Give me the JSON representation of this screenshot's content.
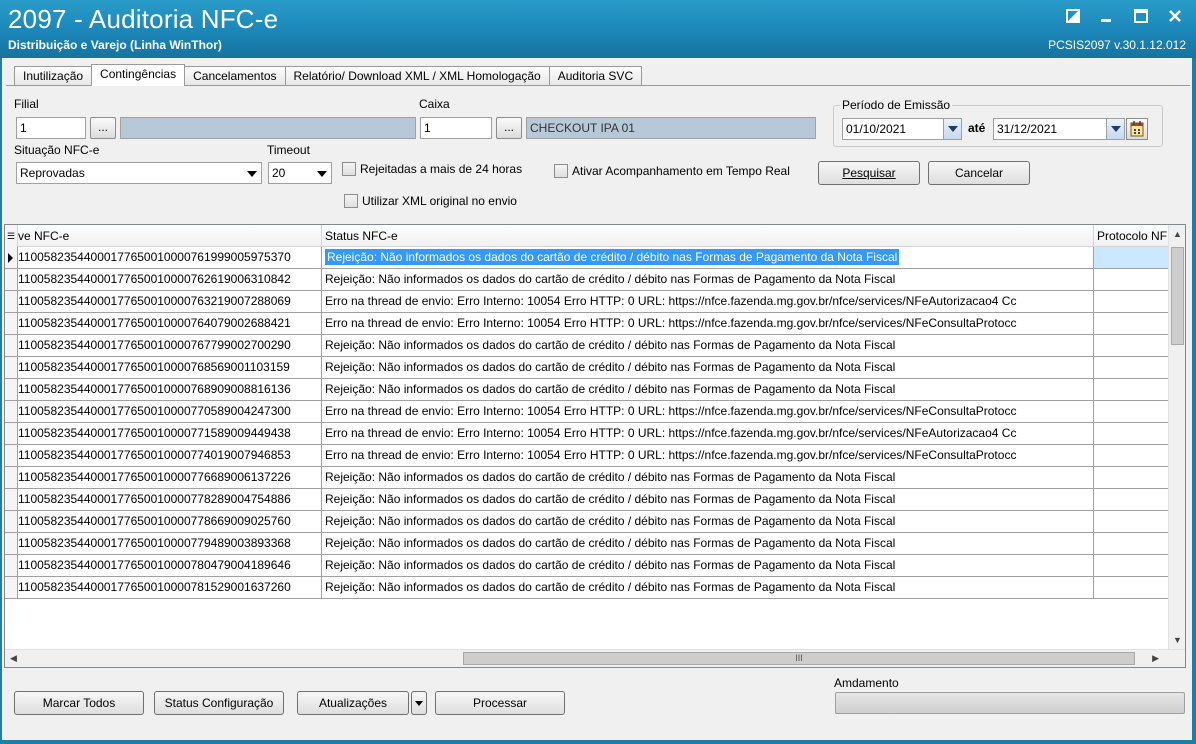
{
  "window": {
    "title": "2097 - Auditoria NFC-e",
    "subtitle": "Distribuição e Varejo (Linha WinThor)",
    "version": "PCSIS2097  v.30.1.12.012"
  },
  "tabs": [
    {
      "label": "Inutilização"
    },
    {
      "label": "Contingências"
    },
    {
      "label": "Cancelamentos"
    },
    {
      "label": "Relatório/ Download XML / XML Homologação"
    },
    {
      "label": "Auditoria SVC"
    }
  ],
  "filters": {
    "filial_label": "Filial",
    "filial_value": "1",
    "filial_name": "",
    "caixa_label": "Caixa",
    "caixa_value": "1",
    "caixa_name": "CHECKOUT IPA 01",
    "periodo_label": "Período de Emissão",
    "date_from": "01/10/2021",
    "ate_label": "até",
    "date_to": "31/12/2021",
    "situacao_label": "Situação NFC-e",
    "situacao_value": "Reprovadas",
    "timeout_label": "Timeout",
    "timeout_value": "20",
    "rejeitadas_label": "Rejeitadas a mais de 24 horas",
    "acompanhamento_label": "Ativar Acompanhamento em Tempo Real",
    "xml_original_label": "Utilizar XML original no envio",
    "dots_label": "...",
    "pesquisar_label": "Pesquisar",
    "cancelar_label": "Cancelar"
  },
  "grid": {
    "columns": [
      "ve NFC-e",
      "Status NFC-e",
      "Protocolo NF"
    ],
    "rows": [
      {
        "chave": "1100582354400017765001000076199900597537​0",
        "status": "Rejeição: Não informados os dados do cartão de crédito / débito nas Formas de Pagamento da Nota Fiscal",
        "selected": true
      },
      {
        "chave": "110058235440001776500100007626190063108​42",
        "status": "Rejeição: Não informados os dados do cartão de crédito / débito nas Formas de Pagamento da Nota Fiscal"
      },
      {
        "chave": "110058235440001776500100007632190072880​69",
        "status": " Erro na thread de envio: Erro Interno: 10054 Erro HTTP: 0 URL: https://nfce.fazenda.mg.gov.br/nfce/services/NFeAutorizacao4 Cc"
      },
      {
        "chave": "110058235440001776500100007640790026884​21",
        "status": " Erro na thread de envio: Erro Interno: 10054 Erro HTTP: 0 URL: https://nfce.fazenda.mg.gov.br/nfce/services/NFeConsultaProtocc"
      },
      {
        "chave": "110058235440001776500100007677990027002​90",
        "status": "Rejeição: Não informados os dados do cartão de crédito / débito nas Formas de Pagamento da Nota Fiscal"
      },
      {
        "chave": "110058235440001776500100007685690011031​59",
        "status": "Rejeição: Não informados os dados do cartão de crédito / débito nas Formas de Pagamento da Nota Fiscal"
      },
      {
        "chave": "110058235440001776500100007689090088161​36",
        "status": "Rejeição: Não informados os dados do cartão de crédito / débito nas Formas de Pagamento da Nota Fiscal"
      },
      {
        "chave": "110058235440001776500100007705890042473​00",
        "status": " Erro na thread de envio: Erro Interno: 10054 Erro HTTP: 0 URL: https://nfce.fazenda.mg.gov.br/nfce/services/NFeConsultaProtocc"
      },
      {
        "chave": "110058235440001776500100007715890094494​38",
        "status": " Erro na thread de envio: Erro Interno: 10054 Erro HTTP: 0 URL: https://nfce.fazenda.mg.gov.br/nfce/services/NFeAutorizacao4 Cc"
      },
      {
        "chave": "110058235440001776500100007740190079468​53",
        "status": " Erro na thread de envio: Erro Interno: 10054 Erro HTTP: 0 URL: https://nfce.fazenda.mg.gov.br/nfce/services/NFeConsultaProtocc"
      },
      {
        "chave": "110058235440001776500100007766890061372​26",
        "status": "Rejeição: Não informados os dados do cartão de crédito / débito nas Formas de Pagamento da Nota Fiscal"
      },
      {
        "chave": "110058235440001776500100007782890047548​86",
        "status": "Rejeição: Não informados os dados do cartão de crédito / débito nas Formas de Pagamento da Nota Fiscal"
      },
      {
        "chave": "110058235440001776500100007786690090257​60",
        "status": "Rejeição: Não informados os dados do cartão de crédito / débito nas Formas de Pagamento da Nota Fiscal"
      },
      {
        "chave": "110058235440001776500100007794890038933​68",
        "status": "Rejeição: Não informados os dados do cartão de crédito / débito nas Formas de Pagamento da Nota Fiscal"
      },
      {
        "chave": "110058235440001776500100007804790041896​46",
        "status": "Rejeição: Não informados os dados do cartão de crédito / débito nas Formas de Pagamento da Nota Fiscal"
      },
      {
        "chave": "110058235440001776500100007815290016372​60",
        "status": "Rejeição: Não informados os dados do cartão de crédito / débito nas Formas de Pagamento da Nota Fiscal"
      }
    ],
    "hscroll_grip": "III"
  },
  "bottom": {
    "marcar_todos": "Marcar Todos",
    "status_config": "Status Configuração",
    "atualizacoes": "Atualizações",
    "processar": "Processar",
    "andamento_label": "Amdamento",
    "andamento_progress": 0
  },
  "colors": {
    "titlebar": "#1b86b8",
    "selection": "#3399ff",
    "readonly_field": "#b7c9d8"
  }
}
